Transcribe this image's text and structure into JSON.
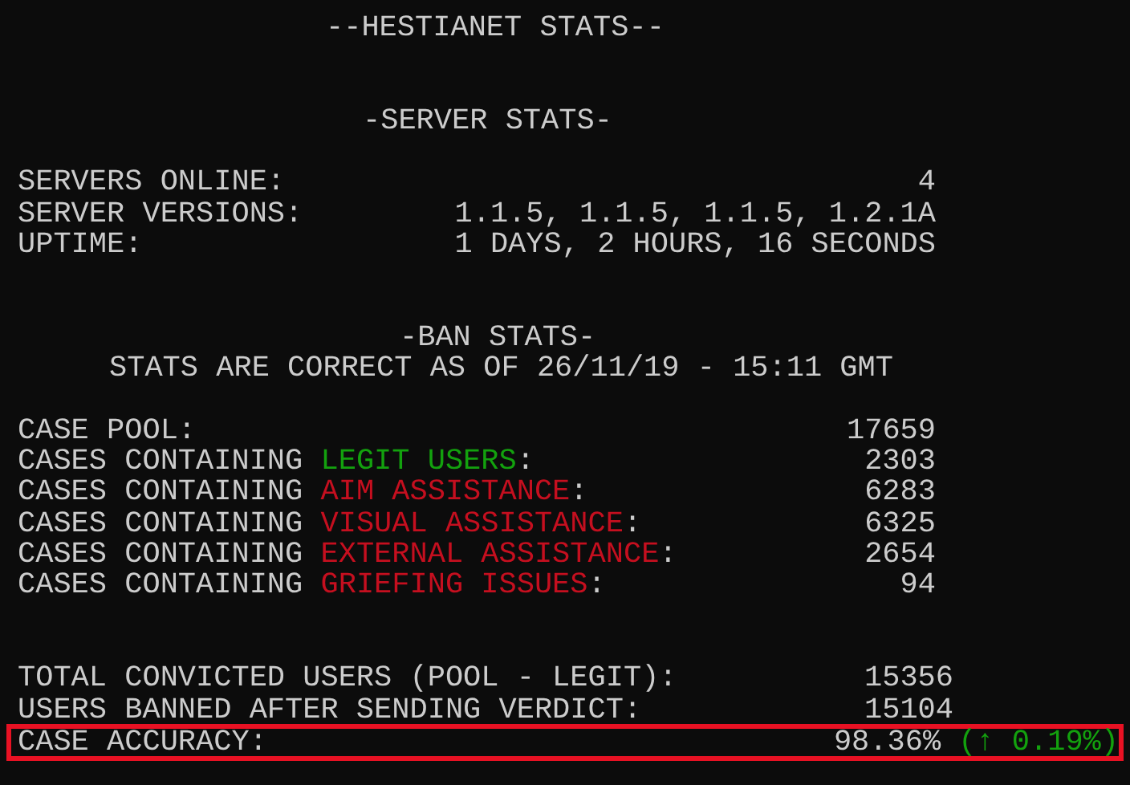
{
  "title": "--HESTIANET STATS--",
  "server_stats": {
    "heading": "-SERVER STATS-",
    "rows": [
      {
        "label": "SERVERS ONLINE:",
        "value": "4"
      },
      {
        "label": "SERVER VERSIONS:",
        "value": "1.1.5, 1.1.5, 1.1.5, 1.2.1A"
      },
      {
        "label": "UPTIME:",
        "value": "1 DAYS, 2 HOURS, 16 SECONDS"
      }
    ]
  },
  "ban_stats": {
    "heading": "-BAN STATS-",
    "note": "STATS ARE CORRECT AS OF 26/11/19 - 15:11 GMT",
    "case_pool": {
      "label": "CASE POOL:",
      "value": "17659"
    },
    "categories": [
      {
        "prefix": "CASES CONTAINING",
        "category": "LEGIT USERS",
        "suffix": ":",
        "color": "#13a10e",
        "value": "2303"
      },
      {
        "prefix": "CASES CONTAINING",
        "category": "AIM ASSISTANCE",
        "suffix": ":",
        "color": "#c50f1f",
        "value": "6283"
      },
      {
        "prefix": "CASES CONTAINING",
        "category": "VISUAL ASSISTANCE",
        "suffix": ":",
        "color": "#c50f1f",
        "value": "6325"
      },
      {
        "prefix": "CASES CONTAINING",
        "category": "EXTERNAL ASSISTANCE",
        "suffix": ":",
        "color": "#c50f1f",
        "value": "2654"
      },
      {
        "prefix": "CASES CONTAINING",
        "category": "GRIEFING ISSUES",
        "suffix": ":",
        "color": "#c50f1f",
        "value": "94"
      }
    ]
  },
  "totals": [
    {
      "label": "TOTAL CONVICTED USERS (POOL - LEGIT):",
      "value": "15356"
    },
    {
      "label": "USERS BANNED AFTER SENDING VERDICT:",
      "value": "15104"
    }
  ],
  "accuracy": {
    "label": "CASE ACCURACY:",
    "value": "98.36%",
    "change": "(↑ 0.19%)",
    "highlighted": true
  }
}
